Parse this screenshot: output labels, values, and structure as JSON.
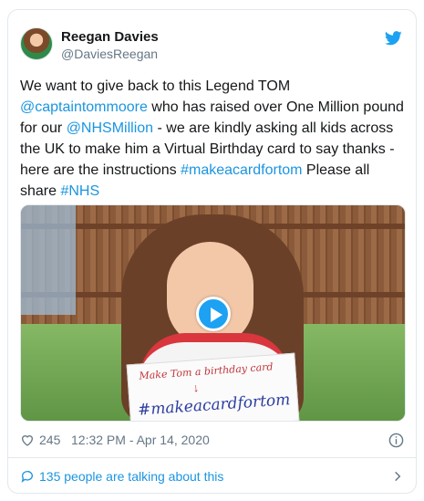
{
  "author": {
    "name": "Reegan Davies",
    "handle": "@DaviesReegan"
  },
  "tweet": {
    "segments": [
      {
        "text": "We want to give back to this Legend TOM ",
        "link": false
      },
      {
        "text": "@captaintommoore",
        "link": true
      },
      {
        "text": " who has raised over One Million pound for our ",
        "link": false
      },
      {
        "text": "@NHSMillion",
        "link": true
      },
      {
        "text": " - we are kindly asking all kids across the UK to make him a Virtual Birthday card to say thanks - here are the instructions ",
        "link": false
      },
      {
        "text": "#makeacardfortom",
        "link": true
      },
      {
        "text": " Please all share ",
        "link": false
      },
      {
        "text": "#NHS",
        "link": true
      }
    ]
  },
  "media": {
    "sign_line1": "Make Tom a birthday card",
    "sign_arrow": "↓",
    "sign_line2": "#makeacardfortom"
  },
  "meta": {
    "likes": "245",
    "timestamp": "12:32 PM - Apr 14, 2020"
  },
  "conversation": {
    "label": "135 people are talking about this"
  },
  "colors": {
    "link": "#1b95e0",
    "twitter_blue": "#1da1f2",
    "muted": "#657786"
  },
  "icons": [
    "twitter-bird-icon",
    "heart-icon",
    "info-icon",
    "comment-bubble-icon",
    "chevron-right-icon",
    "play-icon"
  ]
}
